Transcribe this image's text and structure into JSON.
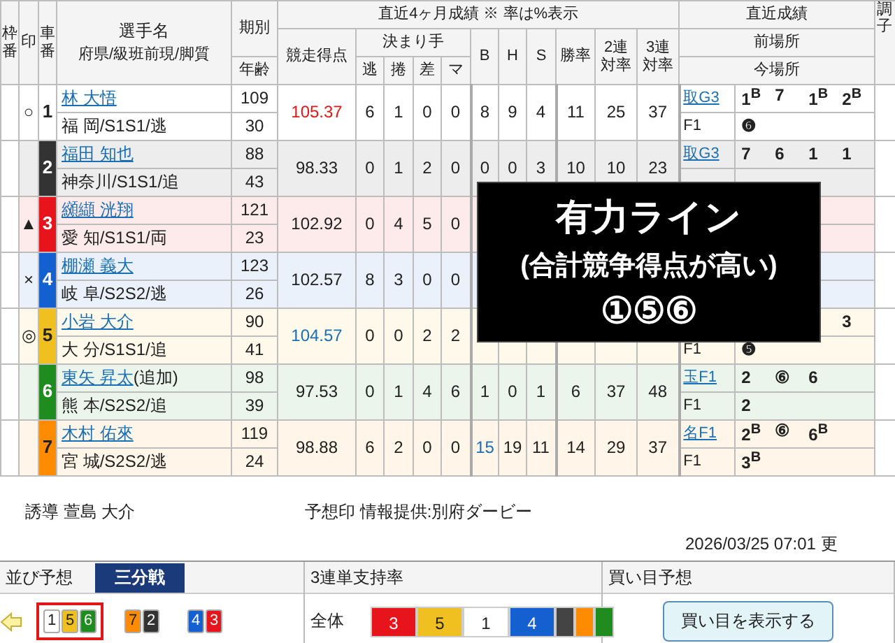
{
  "header": {
    "frame": "枠番",
    "mark": "印",
    "car": "車番",
    "name": "選手名",
    "sub": "府県/級班前現/脚質",
    "period": "期別",
    "age": "年齢",
    "stats": "直近4ヶ月成績 ※ 率は%表示",
    "score": "競走得点",
    "kimarite": "決まり手",
    "kimarite_cols": [
      "逃",
      "捲",
      "差",
      "マ"
    ],
    "bhs": [
      "B",
      "H",
      "S"
    ],
    "rates": [
      "勝率",
      "2連対率",
      "3連対率"
    ],
    "recent": "直近成績",
    "prev": "前場所",
    "cur": "今場所",
    "condition": "調子"
  },
  "riders": [
    {
      "mark": "○",
      "number": "1",
      "color": "#ffffff",
      "name": "林 大悟",
      "profile": "福 岡/S1S1/逃",
      "period": "109",
      "age": "30",
      "score": "105.37",
      "score_top": true,
      "score_second": false,
      "kimarite": [
        "6",
        "1",
        "0",
        "0"
      ],
      "bhs": [
        "8",
        "9",
        "4"
      ],
      "b_top": false,
      "rates": [
        "11",
        "25",
        "37"
      ],
      "prev_venue": "取G3",
      "prev_results": [
        "1$^{B}$",
        "7",
        "1$^{B}$",
        "2$^{B}$"
      ],
      "cur_venue": "F1",
      "cur_results": [
        "❻"
      ]
    },
    {
      "number": "2",
      "color": "#333333",
      "name": "福田 知也",
      "profile": "神奈川/S1S1/追",
      "period": "88",
      "age": "43",
      "score": "98.33",
      "score_top": false,
      "score_second": false,
      "kimarite": [
        "0",
        "1",
        "2",
        "0"
      ],
      "bhs": [
        "0",
        "0",
        "3"
      ],
      "b_top": false,
      "rates": [
        "10",
        "10",
        "23"
      ],
      "prev_venue": "取G3",
      "prev_results": [
        "7",
        "6",
        "1",
        "1"
      ]
    },
    {
      "mark": "▲",
      "number": "3",
      "color": "#e8141c",
      "name": "纐纈 洸翔",
      "profile": "愛 知/S1S1/両",
      "period": "121",
      "age": "23",
      "score": "102.92",
      "score_top": false,
      "score_second": false,
      "kimarite": [
        "0",
        "4",
        "5",
        "0"
      ]
    },
    {
      "mark": "×",
      "number": "4",
      "color": "#1560d0",
      "name": "棚瀬 義大",
      "profile": "岐 阜/S2S2/逃",
      "period": "123",
      "age": "26",
      "score": "102.57",
      "score_top": false,
      "score_second": false,
      "kimarite": [
        "8",
        "3",
        "0",
        "0"
      ]
    },
    {
      "mark": "◎",
      "number": "5",
      "color": "#f0c020",
      "name": "小岩 大介",
      "profile": "大 分/S1S1/追",
      "period": "90",
      "age": "41",
      "score": "104.57",
      "score_top": false,
      "score_second": true,
      "kimarite": [
        "0",
        "0",
        "2",
        "2"
      ],
      "prev_results": [
        "3"
      ],
      "cur_venue": "F1",
      "cur_results": [
        "❺"
      ]
    },
    {
      "number": "6",
      "color": "#1e8c1e",
      "name": "東矢 昇太",
      "name_note": "(追加)",
      "profile": "熊 本/S2S2/追",
      "period": "98",
      "age": "39",
      "score": "97.53",
      "score_top": false,
      "score_second": false,
      "kimarite": [
        "0",
        "1",
        "4",
        "6"
      ],
      "bhs": [
        "1",
        "0",
        "1"
      ],
      "b_top": false,
      "rates": [
        "6",
        "37",
        "48"
      ],
      "prev_venue": "玉F1",
      "prev_results": [
        "2",
        "⑥",
        "6"
      ],
      "cur_venue": "F1",
      "cur_results": [
        "2"
      ]
    },
    {
      "number": "7",
      "color": "#ff8c00",
      "name": "木村 佑來",
      "profile": "宮 城/S2S2/逃",
      "period": "119",
      "age": "24",
      "score": "98.88",
      "score_top": false,
      "score_second": false,
      "kimarite": [
        "6",
        "2",
        "0",
        "0"
      ],
      "bhs": [
        "15",
        "19",
        "11"
      ],
      "b_top": true,
      "rates": [
        "14",
        "29",
        "37"
      ],
      "prev_venue": "名F1",
      "prev_results": [
        "2$^{B}$",
        "⑥",
        "6$^{B}$"
      ],
      "cur_venue": "F1",
      "cur_results": [
        "3$^{B}$"
      ]
    }
  ],
  "overlay": {
    "title": "有力ライン",
    "subtitle": "(合計競争得点が高い)",
    "line": "①⑤⑥"
  },
  "info": {
    "pacer": "誘導 萱島 大介",
    "credit": "予想印 情報提供:別府ダービー",
    "updated": "2026/03/25 07:01 更"
  },
  "lineup": {
    "title": "並び予想",
    "race_type": "三分戦",
    "groups": [
      {
        "highlighted": true,
        "cars": [
          {
            "number": "1",
            "color": "#ffffff"
          },
          {
            "number": "5",
            "color": "#f0c020"
          },
          {
            "number": "6",
            "color": "#1e8c1e"
          }
        ]
      },
      {
        "highlighted": false,
        "cars": [
          {
            "number": "7",
            "color": "#ff8c00"
          },
          {
            "number": "2",
            "color": "#333333"
          }
        ]
      },
      {
        "highlighted": false,
        "cars": [
          {
            "number": "4",
            "color": "#1560d0"
          },
          {
            "number": "3",
            "color": "#e8141c"
          }
        ]
      }
    ]
  },
  "support": {
    "title": "3連単支持率",
    "label": "全体",
    "segments": [
      {
        "number": "3",
        "color": "#e8141c"
      },
      {
        "number": "5",
        "color": "#f0c020"
      },
      {
        "number": "1",
        "color": "#ffffff"
      },
      {
        "number": "4",
        "color": "#1560d0"
      },
      {
        "color": "#444444"
      },
      {
        "color": "#ff8c00"
      },
      {
        "color": "#1e8c1e"
      }
    ]
  },
  "bets": {
    "title": "買い目予想",
    "button": "買い目を表示する"
  }
}
